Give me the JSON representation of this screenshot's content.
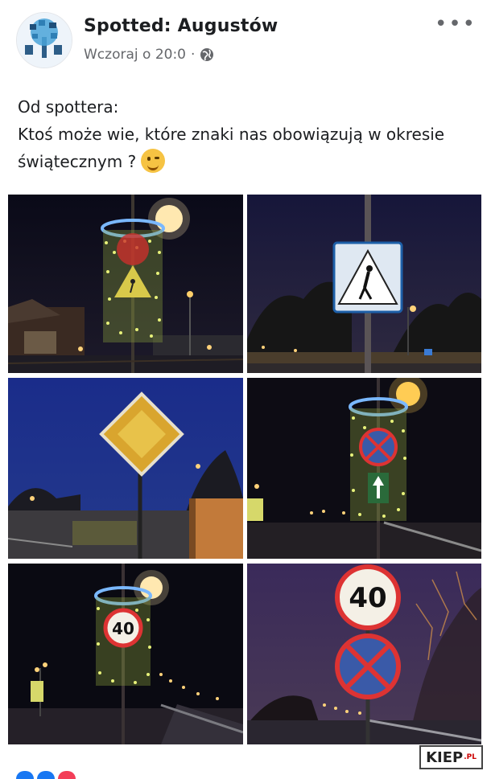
{
  "post": {
    "page_name": "Spotted: Augustów",
    "timestamp": "Wczoraj o 20:0",
    "separator": "·",
    "privacy_icon": "globe-icon",
    "more_icon": "more-horizontal-icon",
    "text_line1": "Od spottera:",
    "text_line2": "Ktoś może wie, które znaki nas obowiązują w okresie świątecznym ?",
    "emoji": "winking-face-emoji"
  },
  "photos": [
    {
      "alt": "lit christmas decoration with pedestrian crossing sign",
      "sign_text": ""
    },
    {
      "alt": "pedestrian crossing sign on pole",
      "sign_text": ""
    },
    {
      "alt": "priority road sign",
      "sign_text": ""
    },
    {
      "alt": "lit decoration with no stopping and go straight signs",
      "sign_text": ""
    },
    {
      "alt": "lit decoration with speed limit sign",
      "sign_text": "40"
    },
    {
      "alt": "speed limit and no stopping signs",
      "sign_text": "40"
    }
  ],
  "watermark": {
    "text": "KIEP",
    "suffix": ".PL"
  },
  "colors": {
    "accent": "#1877f2",
    "secondary_text": "#65676b"
  }
}
